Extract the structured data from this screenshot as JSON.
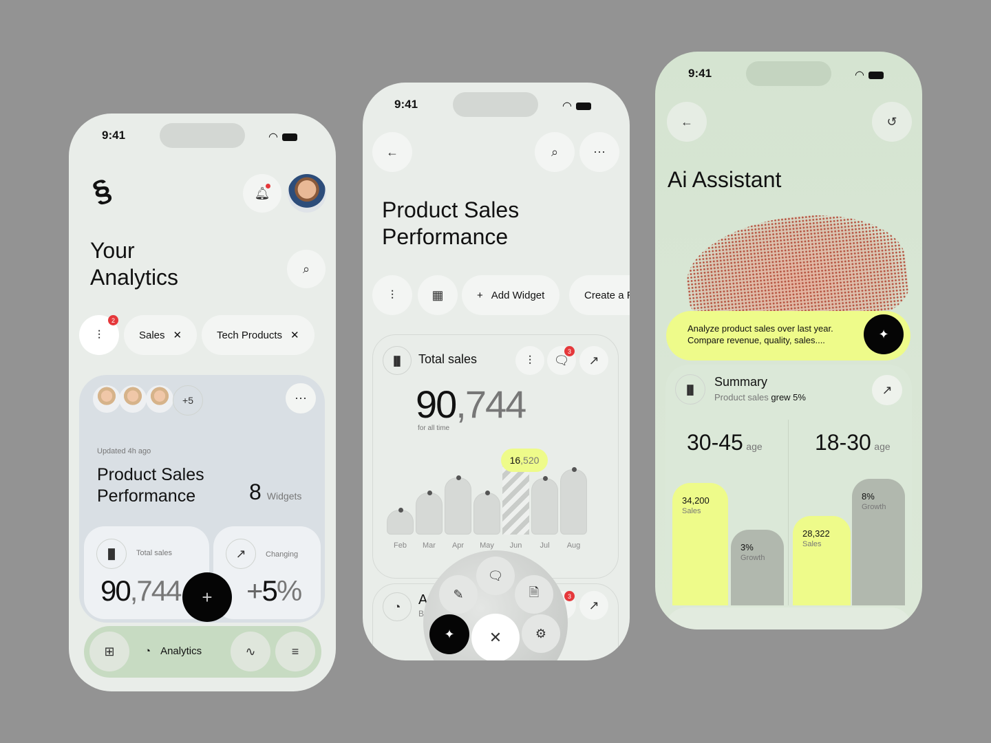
{
  "status": {
    "time": "9:41"
  },
  "colors": {
    "background": "#939393",
    "accent_yellow": "#eefb8a",
    "badge_red": "#e5383b",
    "dark": "#0a0a0a"
  },
  "phone1": {
    "title_line1": "Your",
    "title_line2": "Analytics",
    "filter_badge": "2",
    "chips": [
      {
        "label": "Sales"
      },
      {
        "label": "Tech Products"
      }
    ],
    "card": {
      "more_count": "+5",
      "updated": "Updated 4h ago",
      "title_line1": "Product Sales",
      "title_line2": "Performance",
      "widgets_count": "8",
      "widgets_label": "Widgets",
      "total_sales_label": "Total sales",
      "total_sales_int": "90",
      "total_sales_frac": ",744",
      "changing_label": "Changing",
      "changing_sign": "+",
      "changing_value": "5",
      "changing_pct": "%"
    },
    "nav": {
      "active_label": "Analytics"
    },
    "icons": [
      "logo",
      "bell-icon",
      "search-icon",
      "filter-icon",
      "close-icon",
      "more-icon",
      "bar-chart-icon",
      "trend-up-icon",
      "plus-icon",
      "grid-icon",
      "pie-chart-icon",
      "pulse-icon",
      "database-icon"
    ]
  },
  "phone2": {
    "title_line1": "Product Sales",
    "title_line2": "Performance",
    "toolbar": {
      "add_widget": "Add Widget",
      "create": "Create a R"
    },
    "total_card": {
      "title": "Total sales",
      "badge": "3",
      "value_int": "90",
      "value_frac": ",744",
      "caption": "for all time"
    },
    "chart": {
      "type": "bar",
      "categories": [
        "Feb",
        "Mar",
        "Apr",
        "May",
        "Jun",
        "Jul",
        "Aug"
      ],
      "values": [
        5500,
        9300,
        12700,
        9300,
        16520,
        12500,
        14500
      ],
      "highlight": "Jun",
      "tooltip_int": "16",
      "tooltip_frac": ",520"
    },
    "second_card": {
      "title_partial": "Ac",
      "subtitle_partial": "Br",
      "badge": "3"
    },
    "radial_menu": [
      "chat-icon",
      "brush-icon",
      "report-icon",
      "magic-wand-icon",
      "close-icon",
      "settings-icon"
    ]
  },
  "phone3": {
    "title": "Ai Assistant",
    "prompt_line1": "Analyze product sales over last year.",
    "prompt_line2": "Compare revenue, quality, sales....",
    "summary": {
      "title": "Summary",
      "subtitle_muted": "Product sales",
      "subtitle_strong": "grew 5%"
    },
    "groups": [
      {
        "range": "30-45",
        "unit": "age",
        "sales": "34,200",
        "sales_label": "Sales",
        "growth": "3%",
        "growth_label": "Growth"
      },
      {
        "range": "18-30",
        "unit": "age",
        "sales": "28,322",
        "sales_label": "Sales",
        "growth": "8%",
        "growth_label": "Growth"
      }
    ]
  }
}
